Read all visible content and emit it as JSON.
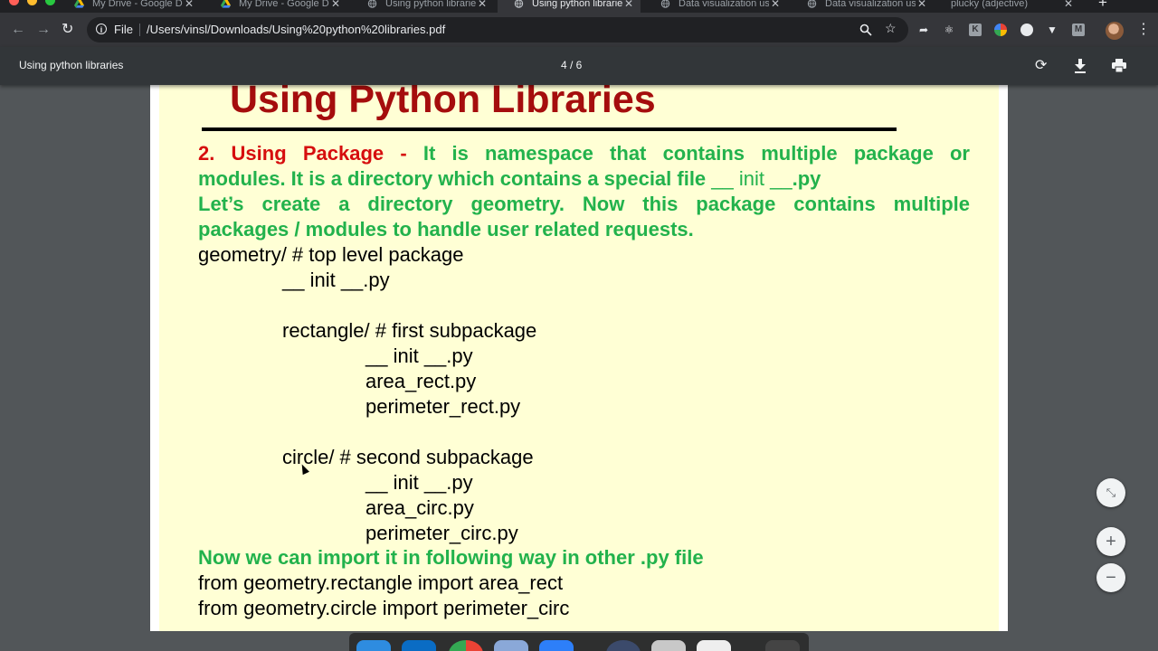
{
  "browser": {
    "tabs": [
      {
        "title": "My Drive - Google Drive",
        "favicon": "google-drive-icon",
        "active": false
      },
      {
        "title": "My Drive - Google Drive",
        "favicon": "google-drive-icon",
        "active": false
      },
      {
        "title": "Using python libraries",
        "favicon": "globe-icon",
        "active": false
      },
      {
        "title": "Using python libraries",
        "favicon": "globe-icon",
        "active": true
      },
      {
        "title": "Data visualization using",
        "favicon": "globe-icon",
        "active": false
      },
      {
        "title": "Data visualization using",
        "favicon": "globe-icon",
        "active": false
      },
      {
        "title": "plucky (adjective)",
        "favicon": "",
        "active": false
      }
    ],
    "address_scheme": "File",
    "address_url": "/Users/vinsl/Downloads/Using%20python%20libraries.pdf"
  },
  "pdf_viewer": {
    "title": "Using python libraries",
    "page_indicator": "4 / 6"
  },
  "slide": {
    "heading": "Using Python Libraries",
    "intro_lines": [
      {
        "red": "2. Using Package - ",
        "green": "It is namespace that contains multiple package or"
      },
      {
        "green": "modules. It is a directory which contains a special file ",
        "light": "__ init __",
        "tail": ".py"
      },
      {
        "green": "Let’s create a directory geometry. Now this package contains multiple"
      },
      {
        "green": "packages / modules to handle user related requests."
      }
    ],
    "tree": [
      "geometry/ # top level package",
      "__ init __.py",
      "rectangle/ # first subpackage",
      "__ init __.py",
      "area_rect.py",
      "perimeter_rect.py",
      "circle/ # second subpackage",
      "__ init __.py",
      "area_circ.py",
      "perimeter_circ.py"
    ],
    "import_note": "Now we can import it in following way in other .py file",
    "imports": [
      "from geometry.rectangle import area_rect",
      "from geometry.circle import perimeter_circ"
    ]
  },
  "colors": {
    "slide_background": "#ffffd5",
    "heading": "#a50d0d",
    "green_text": "#22b24c",
    "red_text": "#d60e0e",
    "viewer_background": "#525659"
  }
}
